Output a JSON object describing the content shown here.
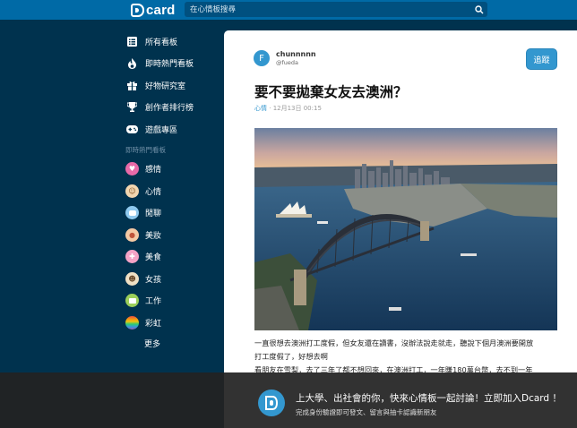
{
  "header": {
    "logo_text": "card",
    "search_placeholder": "在心情板搜尋"
  },
  "sidebar": {
    "nav": [
      {
        "label": "所有看板",
        "icon": "list-icon"
      },
      {
        "label": "即時熱門看板",
        "icon": "fire-icon"
      },
      {
        "label": "好物研究室",
        "icon": "gift-icon"
      },
      {
        "label": "創作者排行榜",
        "icon": "trophy-icon"
      },
      {
        "label": "遊戲專區",
        "icon": "gamepad-icon"
      }
    ],
    "section_title": "即時熱門看板",
    "boards": [
      {
        "label": "感情",
        "icon": "heart-icon",
        "color": "#e86aa8"
      },
      {
        "label": "心情",
        "icon": "face-icon",
        "color": "#f2d6b0"
      },
      {
        "label": "閒聊",
        "icon": "chat-icon",
        "color": "#8fc9ee"
      },
      {
        "label": "美妝",
        "icon": "makeup-icon",
        "color": "#f5c9a4"
      },
      {
        "label": "美食",
        "icon": "food-icon",
        "color": "#f4a3c6"
      },
      {
        "label": "女孩",
        "icon": "girl-icon",
        "color": "#f0e0c4"
      },
      {
        "label": "工作",
        "icon": "briefcase-icon",
        "color": "#9ccf5a"
      },
      {
        "label": "彩虹",
        "icon": "rainbow-icon",
        "color": "#e9a23b"
      }
    ],
    "more_label": "更多"
  },
  "post": {
    "author_initial": "F",
    "author_name": "chunnnnn",
    "author_id": "@fueda",
    "follow_label": "追蹤",
    "title": "要不要拋棄女友去澳洲？",
    "board": "心情",
    "date": "12月13日 00:15",
    "paragraphs": [
      "一直很想去澳洲打工度假，但女友還在讀書，沒辦法說走就走，聽說下個月澳洲要開放",
      "打工度假了，好想去啊",
      "看朋友在雪梨，去了三年了都不想回來，在澳洲打工，一年賺180萬台幣，去不到一年"
    ]
  },
  "banner": {
    "title": "上大學、出社會的你，快來心情板一起討論！立即加入Dcard ！",
    "subtitle": "完成身份驗證即可發文、留言與抽卡認識新朋友"
  }
}
